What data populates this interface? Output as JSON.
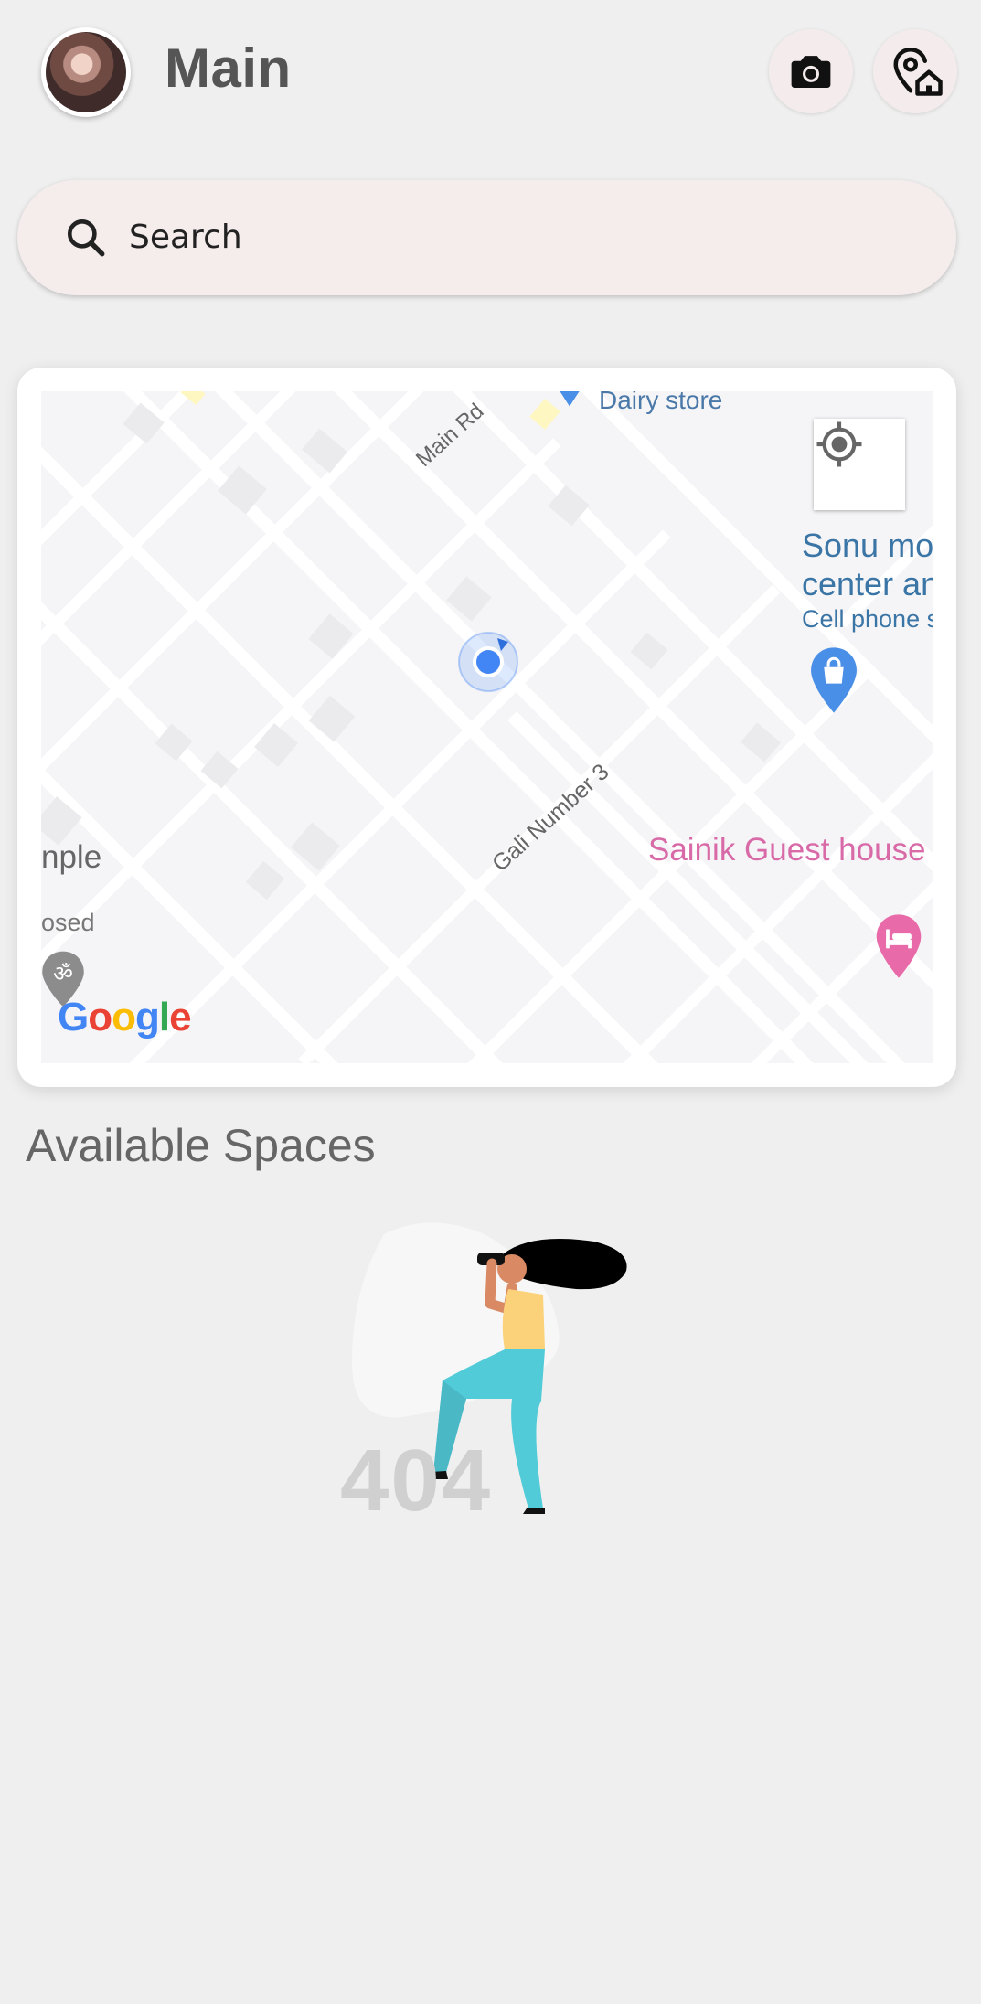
{
  "header": {
    "title": "Main",
    "avatar_icon": "profile-avatar",
    "camera_icon": "camera-icon",
    "home_location_icon": "home-location-icon"
  },
  "search": {
    "placeholder": "Search",
    "icon": "search-icon"
  },
  "map": {
    "labels": {
      "dairy_store": "Dairy store",
      "main_rd": "Main Rd",
      "sonu_line1": "Sonu mo",
      "sonu_line2": "center an",
      "cell_phone": "Cell phone s",
      "gali_number": "Gali Number 3",
      "sainik": "Sainik Guest house",
      "temple_fragment": "nple",
      "closed_fragment": "osed"
    },
    "logo": "Google",
    "colors": {
      "road": "#ffffff",
      "block": "#f5f5f7",
      "poi_blue": "#4a8fe7",
      "poi_pink": "#e86aa8",
      "location_dot": "#4285f4"
    }
  },
  "available_spaces": {
    "title": "Available Spaces",
    "empty_state_code": "404"
  }
}
